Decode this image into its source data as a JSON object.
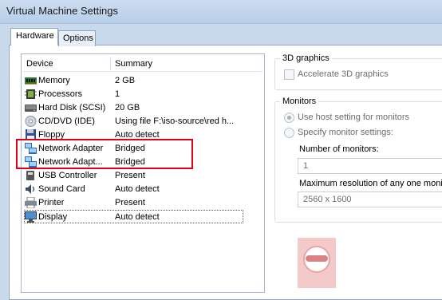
{
  "window": {
    "title": "Virtual Machine Settings"
  },
  "tabs": [
    {
      "label": "Hardware",
      "active": true
    },
    {
      "label": "Options",
      "active": false
    }
  ],
  "device_list": {
    "columns": [
      "Device",
      "Summary"
    ],
    "rows": [
      {
        "icon": "memory-icon",
        "device": "Memory",
        "summary": "2 GB"
      },
      {
        "icon": "processor-icon",
        "device": "Processors",
        "summary": "1"
      },
      {
        "icon": "hard-disk-icon",
        "device": "Hard Disk (SCSI)",
        "summary": "20 GB"
      },
      {
        "icon": "cd-dvd-icon",
        "device": "CD/DVD (IDE)",
        "summary": "Using file F:\\iso-source\\red h..."
      },
      {
        "icon": "floppy-icon",
        "device": "Floppy",
        "summary": "Auto detect"
      },
      {
        "icon": "network-adapter-icon",
        "device": "Network Adapter",
        "summary": "Bridged"
      },
      {
        "icon": "network-adapter-icon",
        "device": "Network Adapt...",
        "summary": "Bridged"
      },
      {
        "icon": "usb-icon",
        "device": "USB Controller",
        "summary": "Present"
      },
      {
        "icon": "sound-card-icon",
        "device": "Sound Card",
        "summary": "Auto detect"
      },
      {
        "icon": "printer-icon",
        "device": "Printer",
        "summary": "Present"
      },
      {
        "icon": "display-icon",
        "device": "Display",
        "summary": "Auto detect",
        "selected": true
      }
    ]
  },
  "graphics_3d": {
    "title": "3D graphics",
    "accelerate_label": "Accelerate 3D graphics",
    "accelerate_checked": false
  },
  "monitors": {
    "title": "Monitors",
    "use_host_label": "Use host setting for monitors",
    "specify_label": "Specify monitor settings:",
    "selected": "use_host",
    "number_label": "Number of monitors:",
    "number_value": "1",
    "max_res_label": "Maximum resolution of any one monitor",
    "max_res_value": "2560 x 1600"
  },
  "colors": {
    "highlight_border": "#e0001a"
  }
}
